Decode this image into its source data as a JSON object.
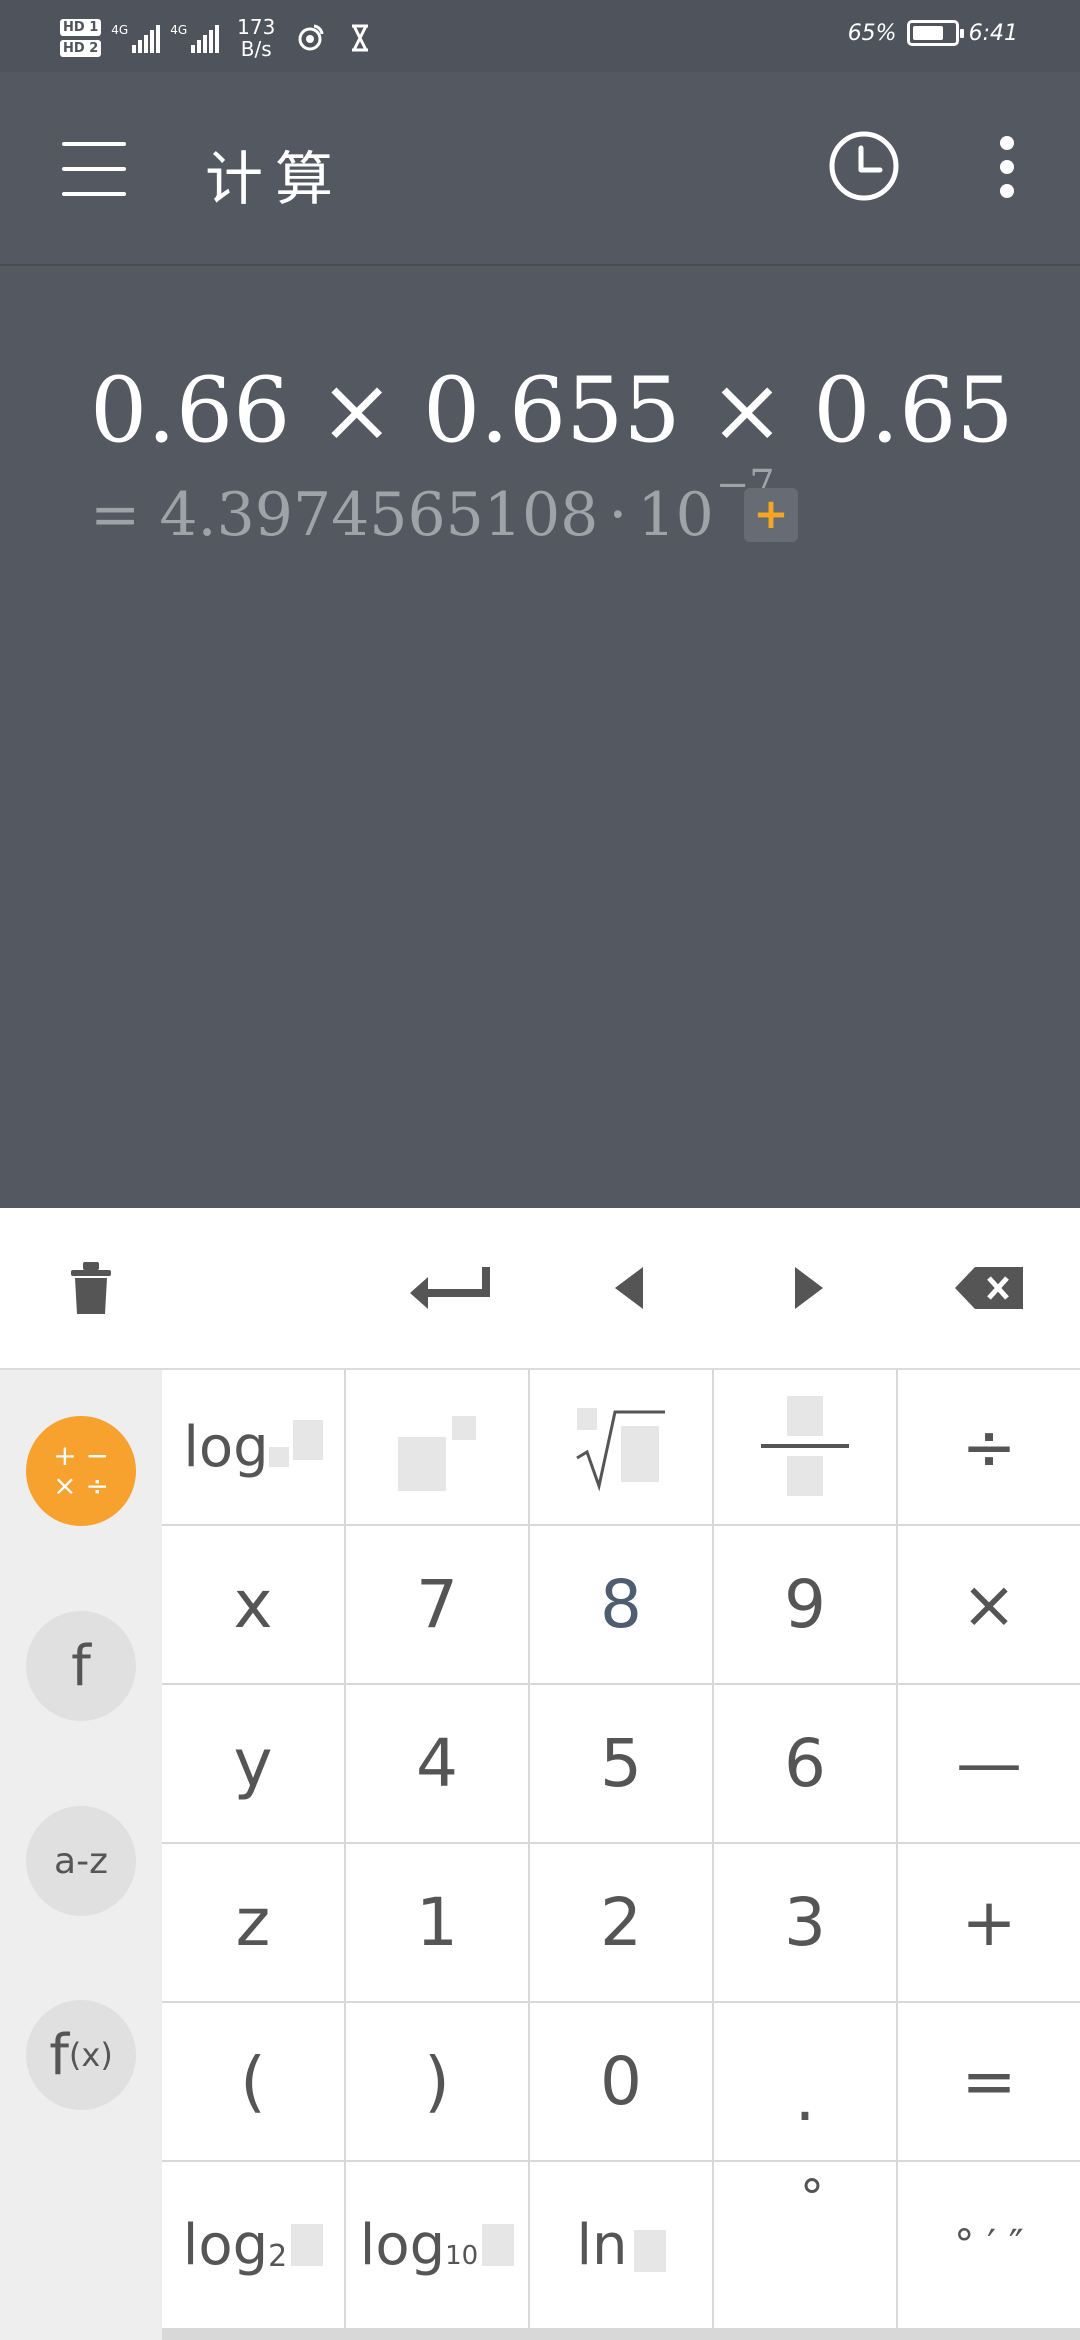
{
  "status_bar": {
    "hd1": "HD 1",
    "hd2": "HD 2",
    "net1": "4G",
    "net2": "4G",
    "speed_value": "173",
    "speed_unit": "B/s",
    "battery": "65%",
    "time": "6:41"
  },
  "app_bar": {
    "title": "计算",
    "menu_icon": "hamburger-icon",
    "history_icon": "clock-icon",
    "more_icon": "more-vertical-icon"
  },
  "display": {
    "expression": "0.66 × 0.655 × 0.65",
    "result_prefix": "= 4.3974565108",
    "result_dot": "·",
    "result_base": "10",
    "result_exp": "−7",
    "add_label": "+"
  },
  "toolbar": {
    "clear_icon": "trash-icon",
    "enter_icon": "enter-icon",
    "left_icon": "arrow-left-icon",
    "right_icon": "arrow-right-icon",
    "backspace_icon": "backspace-icon"
  },
  "sidebar": {
    "ops_top": "+ −",
    "ops_bottom": "× ÷",
    "func": "f",
    "vars": "a-z",
    "fx_f": "f",
    "fx_x": "(x)"
  },
  "keys": {
    "log": "log",
    "divide": "÷",
    "x": "x",
    "k7": "7",
    "k8": "8",
    "k9": "9",
    "multiply": "×",
    "y": "y",
    "k4": "4",
    "k5": "5",
    "k6": "6",
    "minus": "—",
    "z": "z",
    "k1": "1",
    "k2": "2",
    "k3": "3",
    "plus": "+",
    "lparen": "(",
    "rparen": ")",
    "k0": "0",
    "dot": ".",
    "equals": "=",
    "log2_text": "log",
    "log2_sub": "2",
    "log10_text": "log",
    "log10_sub": "10",
    "ln": "ln",
    "degree": "°",
    "dms": "° ′ ″"
  },
  "colors": {
    "display_bg": "#535861",
    "accent": "#f7a12e",
    "keypad_bg": "#eeeeee"
  }
}
